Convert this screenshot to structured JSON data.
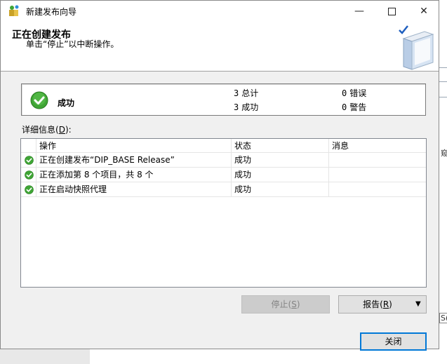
{
  "window": {
    "title": "新建发布向导"
  },
  "header": {
    "title": "正在创建发布",
    "subtitle": "单击“停止”以中断操作。"
  },
  "summary": {
    "status": "成功",
    "total": {
      "count": "3",
      "label": "总计"
    },
    "success": {
      "count": "3",
      "label": "成功"
    },
    "error": {
      "count": "0",
      "label": "错误"
    },
    "warning": {
      "count": "0",
      "label": "警告"
    }
  },
  "details": {
    "label": "详细信息",
    "label_key_open": "(",
    "label_key": "D",
    "label_key_close": "):",
    "columns": {
      "action": "操作",
      "status": "状态",
      "message": "消息"
    },
    "rows": [
      {
        "action": "正在创建发布“DIP_BASE Release”",
        "status": "成功",
        "message": ""
      },
      {
        "action": "正在添加第 8 个项目，共 8 个",
        "status": "成功",
        "message": ""
      },
      {
        "action": "正在启动快照代理",
        "status": "成功",
        "message": ""
      }
    ]
  },
  "buttons": {
    "stop": {
      "label": "停止",
      "key_open": "(",
      "key": "S",
      "key_close": ")"
    },
    "report": {
      "label": "报告",
      "key_open": "(",
      "key": "R",
      "key_close": ")"
    },
    "close": {
      "label": "关闭"
    }
  },
  "background": {
    "fragment_1": "窥",
    "fragment_2": "S("
  },
  "colors": {
    "success_green": "#3fa535",
    "close_border": "#0078d7"
  },
  "icons": [
    "app-icon",
    "book-icon",
    "check-circle-icon",
    "chevron-down-icon"
  ]
}
